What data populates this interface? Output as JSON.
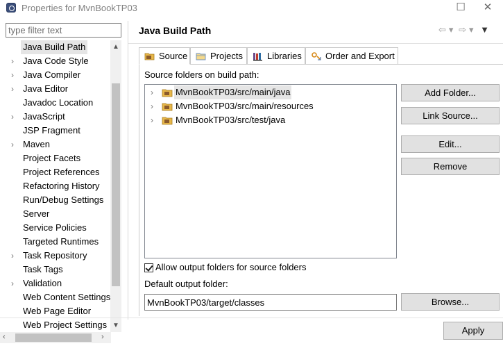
{
  "window": {
    "title": "Properties for MvnBookTP03",
    "maximize_glyph": "☐",
    "close_glyph": "✕"
  },
  "filter": {
    "placeholder": "type filter text",
    "value": ""
  },
  "tree": {
    "items": [
      {
        "label": "Java Build Path",
        "expandable": false,
        "selected": true
      },
      {
        "label": "Java Code Style",
        "expandable": true,
        "selected": false
      },
      {
        "label": "Java Compiler",
        "expandable": true,
        "selected": false
      },
      {
        "label": "Java Editor",
        "expandable": true,
        "selected": false
      },
      {
        "label": "Javadoc Location",
        "expandable": false,
        "selected": false
      },
      {
        "label": "JavaScript",
        "expandable": true,
        "selected": false
      },
      {
        "label": "JSP Fragment",
        "expandable": false,
        "selected": false
      },
      {
        "label": "Maven",
        "expandable": true,
        "selected": false
      },
      {
        "label": "Project Facets",
        "expandable": false,
        "selected": false
      },
      {
        "label": "Project References",
        "expandable": false,
        "selected": false
      },
      {
        "label": "Refactoring History",
        "expandable": false,
        "selected": false
      },
      {
        "label": "Run/Debug Settings",
        "expandable": false,
        "selected": false
      },
      {
        "label": "Server",
        "expandable": false,
        "selected": false
      },
      {
        "label": "Service Policies",
        "expandable": false,
        "selected": false
      },
      {
        "label": "Targeted Runtimes",
        "expandable": false,
        "selected": false
      },
      {
        "label": "Task Repository",
        "expandable": true,
        "selected": false
      },
      {
        "label": "Task Tags",
        "expandable": false,
        "selected": false
      },
      {
        "label": "Validation",
        "expandable": true,
        "selected": false
      },
      {
        "label": "Web Content Settings",
        "expandable": false,
        "selected": false
      },
      {
        "label": "Web Page Editor",
        "expandable": false,
        "selected": false
      },
      {
        "label": "Web Project Settings",
        "expandable": false,
        "selected": false
      }
    ]
  },
  "page": {
    "title": "Java Build Path",
    "nav": {
      "back": "⇦",
      "back_menu": "▾",
      "forward": "⇨",
      "forward_menu": "▾",
      "view_menu": "▼"
    }
  },
  "tabs": [
    {
      "label": "Source",
      "icon": "source-folder-icon",
      "active": true
    },
    {
      "label": "Projects",
      "icon": "projects-icon",
      "active": false
    },
    {
      "label": "Libraries",
      "icon": "libraries-icon",
      "active": false
    },
    {
      "label": "Order and Export",
      "icon": "order-export-icon",
      "active": false
    }
  ],
  "source": {
    "section_label": "Source folders on build path:",
    "folders": [
      {
        "label": "MvnBookTP03/src/main/java",
        "selected": true
      },
      {
        "label": "MvnBookTP03/src/main/resources",
        "selected": false
      },
      {
        "label": "MvnBookTP03/src/test/java",
        "selected": false
      }
    ],
    "buttons": {
      "add_folder": "Add Folder...",
      "link_source": "Link Source...",
      "edit": "Edit...",
      "remove": "Remove"
    },
    "allow_output_label": "Allow output folders for source folders",
    "allow_output_checked": true,
    "default_output_label": "Default output folder:",
    "default_output_value": "MvnBookTP03/target/classes",
    "browse_label": "Browse..."
  },
  "footer": {
    "apply_label": "Apply"
  },
  "colors": {
    "selection": "#e5e5e5",
    "button_face": "#e1e1e1",
    "folder_icon": "#e8b84a"
  }
}
